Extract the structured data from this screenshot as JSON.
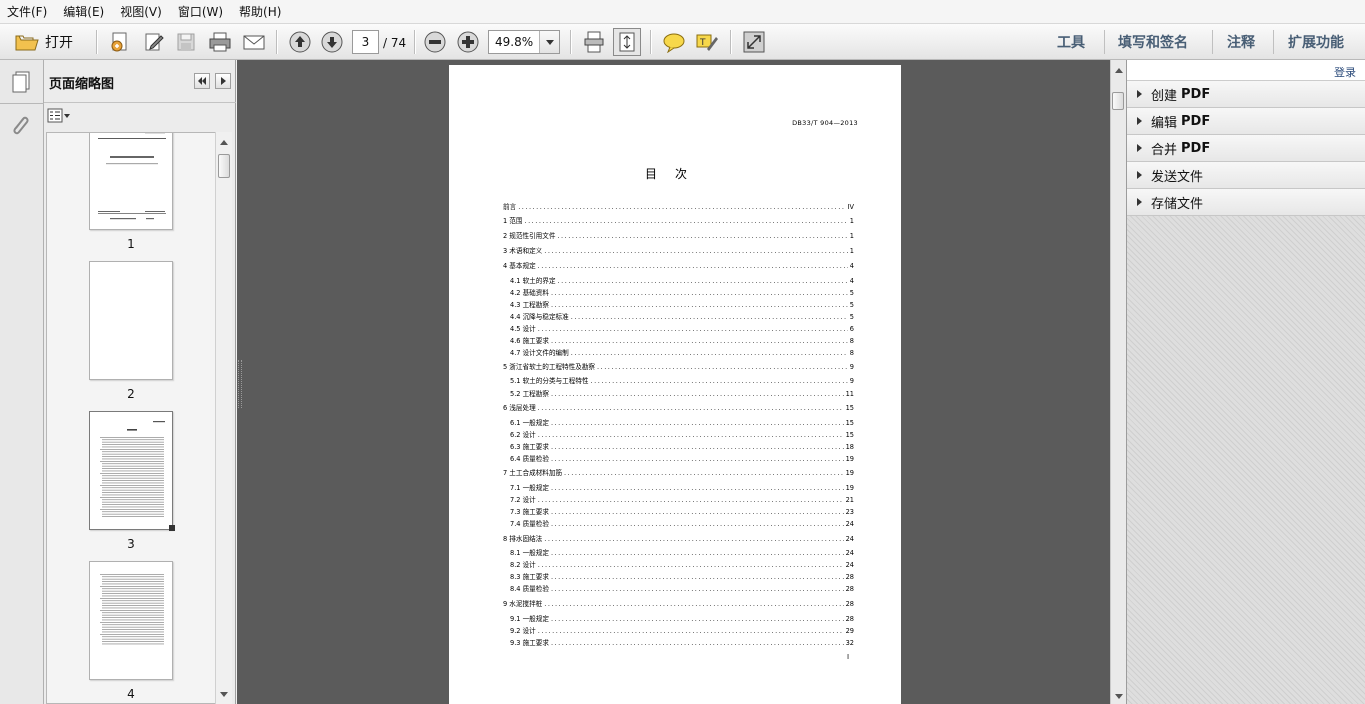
{
  "menu": [
    "文件(F)",
    "编辑(E)",
    "视图(V)",
    "窗口(W)",
    "帮助(H)"
  ],
  "toolbar": {
    "open_label": "打开",
    "current_page": "3",
    "total_pages": "/ 74",
    "zoom": "49.8%",
    "right_tabs": [
      "工具",
      "填写和签名",
      "注释",
      "扩展功能"
    ]
  },
  "thumbnails": {
    "title": "页面缩略图",
    "pages": [
      "1",
      "2",
      "3",
      "4"
    ]
  },
  "document": {
    "code": "DB33/T 904—2013",
    "toc_title": "目次",
    "page_number": "I",
    "toc": [
      {
        "label": "前言",
        "page": "IV",
        "indent": 0
      },
      {
        "label": "1  范围",
        "page": "1",
        "indent": 0
      },
      {
        "label": "2  规范性引用文件",
        "page": "1",
        "indent": 0
      },
      {
        "label": "3  术语和定义",
        "page": "1",
        "indent": 0
      },
      {
        "label": "4  基本规定",
        "page": "4",
        "indent": 0
      },
      {
        "label": "4.1  软土的界定",
        "page": "4",
        "indent": 1
      },
      {
        "label": "4.2  基础资料",
        "page": "5",
        "indent": 1
      },
      {
        "label": "4.3  工程勘察",
        "page": "5",
        "indent": 1
      },
      {
        "label": "4.4  沉降与稳定标准",
        "page": "5",
        "indent": 1
      },
      {
        "label": "4.5  设计",
        "page": "6",
        "indent": 1
      },
      {
        "label": "4.6  施工要求",
        "page": "8",
        "indent": 1
      },
      {
        "label": "4.7  设计文件的编制",
        "page": "8",
        "indent": 1
      },
      {
        "label": "5  浙江省软土的工程特性及勘察",
        "page": "9",
        "indent": 0
      },
      {
        "label": "5.1  软土的分类与工程特性",
        "page": "9",
        "indent": 1
      },
      {
        "label": "5.2  工程勘察",
        "page": "11",
        "indent": 1
      },
      {
        "label": "6  浅层处理",
        "page": "15",
        "indent": 0
      },
      {
        "label": "6.1  一般规定",
        "page": "15",
        "indent": 1
      },
      {
        "label": "6.2  设计",
        "page": "15",
        "indent": 1
      },
      {
        "label": "6.3  施工要求",
        "page": "18",
        "indent": 1
      },
      {
        "label": "6.4  质量检验",
        "page": "19",
        "indent": 1
      },
      {
        "label": "7  土工合成材料加筋",
        "page": "19",
        "indent": 0
      },
      {
        "label": "7.1  一般规定",
        "page": "19",
        "indent": 1
      },
      {
        "label": "7.2  设计",
        "page": "21",
        "indent": 1
      },
      {
        "label": "7.3  施工要求",
        "page": "23",
        "indent": 1
      },
      {
        "label": "7.4  质量检验",
        "page": "24",
        "indent": 1
      },
      {
        "label": "8  排水固结法",
        "page": "24",
        "indent": 0
      },
      {
        "label": "8.1  一般规定",
        "page": "24",
        "indent": 1
      },
      {
        "label": "8.2  设计",
        "page": "24",
        "indent": 1
      },
      {
        "label": "8.3  施工要求",
        "page": "28",
        "indent": 1
      },
      {
        "label": "8.4  质量检验",
        "page": "28",
        "indent": 1
      },
      {
        "label": "9  水泥搅拌桩",
        "page": "28",
        "indent": 0
      },
      {
        "label": "9.1  一般规定",
        "page": "28",
        "indent": 1
      },
      {
        "label": "9.2  设计",
        "page": "29",
        "indent": 1
      },
      {
        "label": "9.3  施工要求",
        "page": "32",
        "indent": 1
      }
    ]
  },
  "right_panel": {
    "login": "登录",
    "items": [
      {
        "label": "创建",
        "suffix": "PDF"
      },
      {
        "label": "编辑",
        "suffix": "PDF"
      },
      {
        "label": "合并",
        "suffix": "PDF"
      },
      {
        "label": "发送文件",
        "suffix": ""
      },
      {
        "label": "存储文件",
        "suffix": ""
      }
    ]
  }
}
